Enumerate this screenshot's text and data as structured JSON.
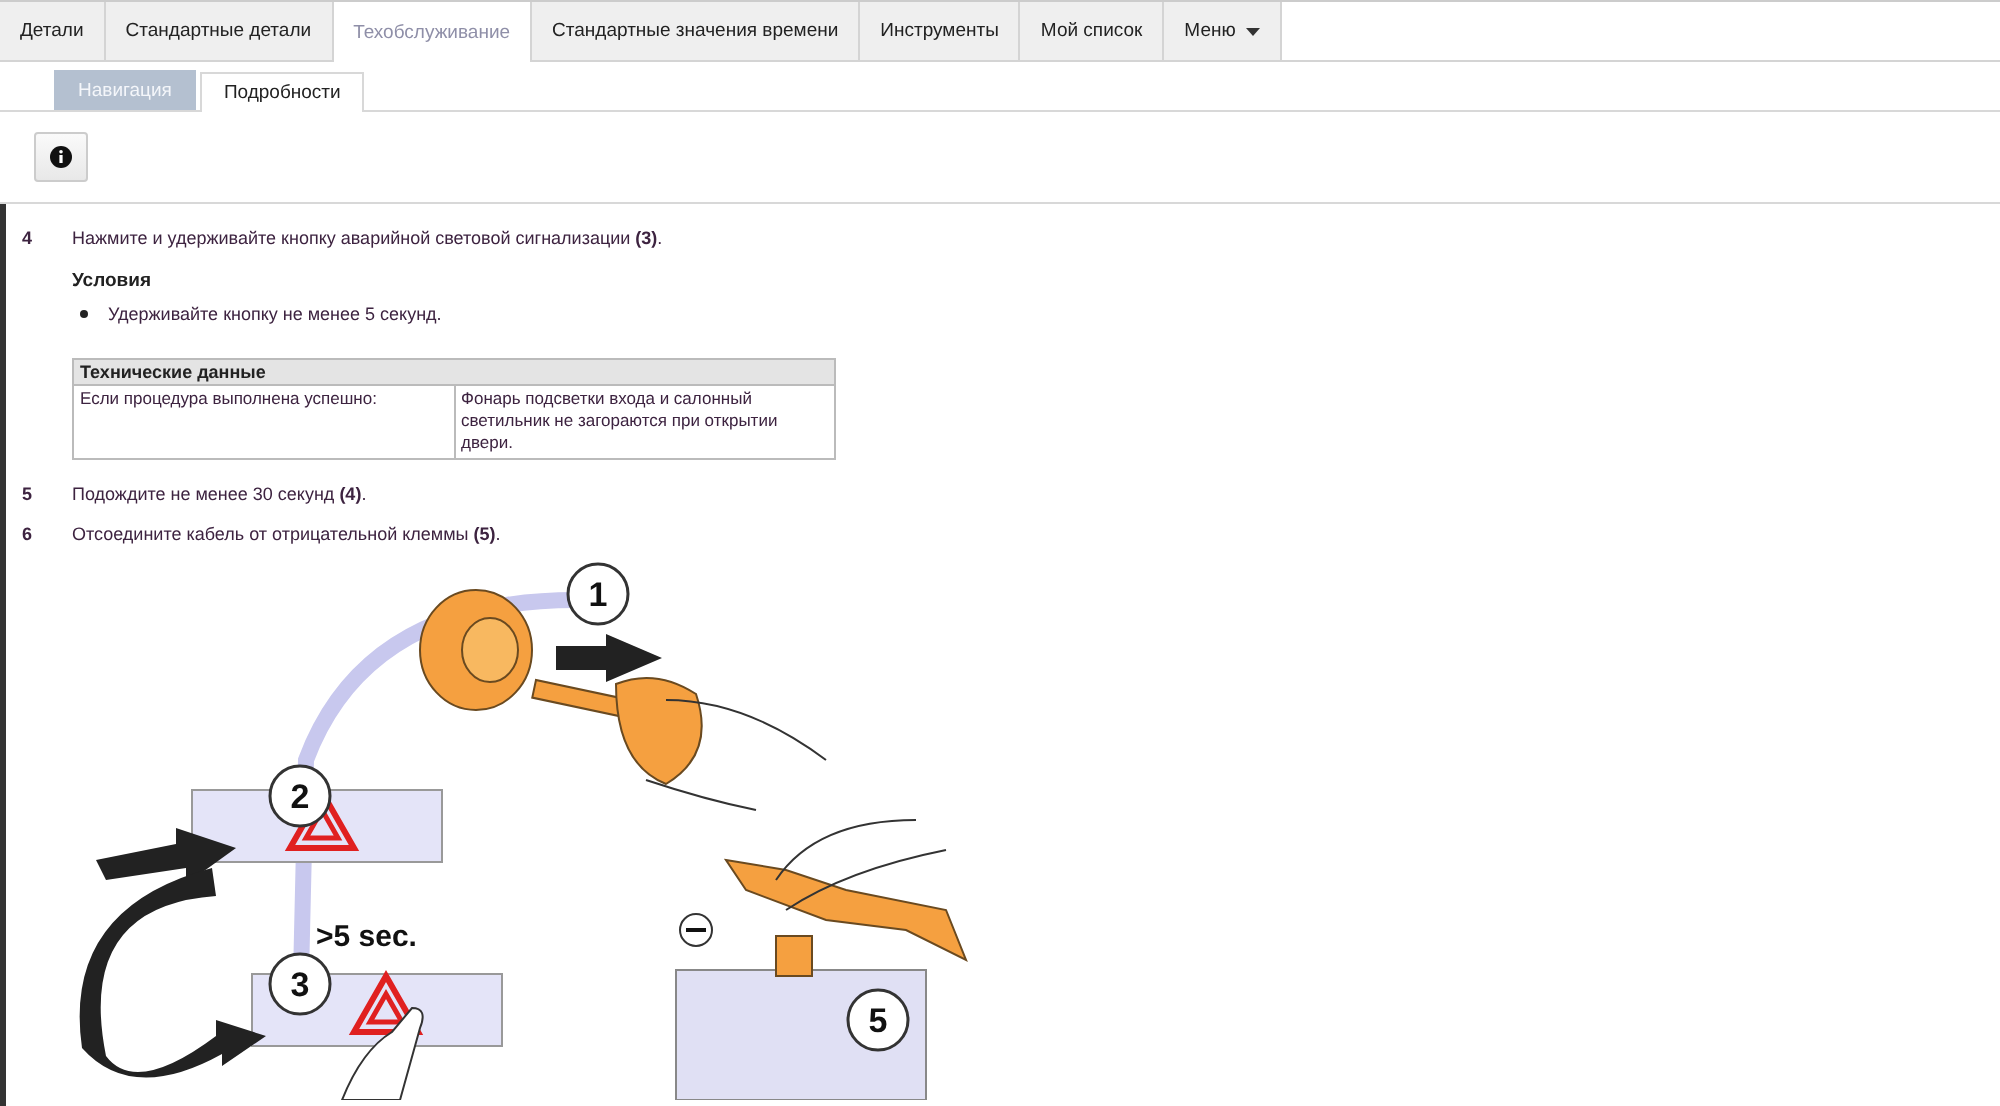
{
  "tabs": [
    {
      "label": "Детали",
      "selected": false
    },
    {
      "label": "Стандартные детали",
      "selected": false
    },
    {
      "label": "Техобслуживание",
      "selected": true
    },
    {
      "label": "Стандартные значения времени",
      "selected": false
    },
    {
      "label": "Инструменты",
      "selected": false
    },
    {
      "label": "Мой список",
      "selected": false
    },
    {
      "label": "Меню",
      "selected": false,
      "kind": "dropdown"
    }
  ],
  "subtabs": [
    {
      "label": "Навигация",
      "selected": false
    },
    {
      "label": "Подробности",
      "selected": true
    }
  ],
  "steps": [
    {
      "number": "4",
      "text": "Нажмите и удерживайте кнопку аварийной световой сигнализации **(3)**.",
      "conditions": {
        "title": "Условия",
        "items": [
          "Удерживайте кнопку не менее 5 секунд."
        ]
      },
      "table": {
        "title": "Технические данные",
        "rows": [
          [
            "Если процедура выполнена успешно:",
            "Фонарь подсветки входа и салонный светильник не загораются при открытии двери."
          ]
        ]
      }
    },
    {
      "number": "5",
      "text": "Подождите не менее 30 секунд **(4)**."
    },
    {
      "number": "6",
      "text": "Отсоедините кабель от отрицательной клеммы **(5)**."
    }
  ],
  "illustration": {
    "callouts": [
      "1",
      "2",
      "3",
      "5"
    ],
    "labels": [
      ">5 sec."
    ]
  }
}
